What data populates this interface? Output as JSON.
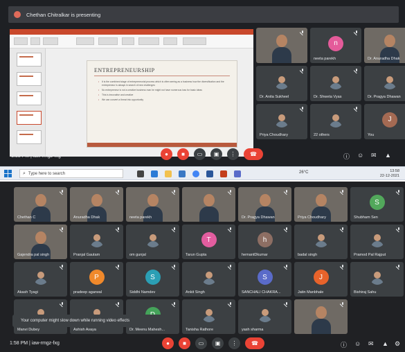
{
  "top": {
    "presenting_banner": "Chethan Chitralkar is presenting",
    "slide": {
      "title": "ENTREPRENEURSHIP",
      "bullets": [
        "It is the combined stage of entrepreneurial process which is often seeing as a business how the diversification and the entrepreneur is always in search of new challenges",
        "No entrepreneur is not a creative business man he might not have numerous loss for basic ideas",
        "This is innovative and creative",
        "We can convert a threat into opportunity"
      ]
    },
    "participants": [
      {
        "name": "",
        "type": "video"
      },
      {
        "name": "neeta parekh",
        "type": "letter",
        "letter": "n",
        "color": "#e45b9a"
      },
      {
        "name": "Dr. Anuradha Dhak",
        "type": "video"
      },
      {
        "name": "Dr. Anita Sukheel",
        "type": "photo"
      },
      {
        "name": "Dr. Shweta Vyas",
        "type": "photo"
      },
      {
        "name": "Dr. Pragya Dhawan",
        "type": "photo"
      },
      {
        "name": "Priya Choudhary",
        "type": "photo"
      },
      {
        "name": "22 others",
        "type": "group"
      },
      {
        "name": "You",
        "type": "letter",
        "letter": "J",
        "color": "#a46a53"
      }
    ],
    "meeting_info": "1:58 PM | iaw-rmgz-fxg"
  },
  "taskbar": {
    "search_placeholder": "Type here to search",
    "weather": "26°C",
    "time": "13:58",
    "date": "22-12-2021"
  },
  "bottom": {
    "participants": [
      {
        "name": "Chethan C",
        "type": "video"
      },
      {
        "name": "Anuradha Dhak",
        "type": "video"
      },
      {
        "name": "neeta parekh",
        "type": "video"
      },
      {
        "name": "",
        "type": "video"
      },
      {
        "name": "Dr. Pragya Dhawan",
        "type": "video"
      },
      {
        "name": "Priya Choudhary",
        "type": "video"
      },
      {
        "name": "Shubham Sen",
        "type": "letter",
        "letter": "S",
        "color": "#52a85b"
      },
      {
        "name": "Gajendra pal singh",
        "type": "video"
      },
      {
        "name": "Pranjal Gautam",
        "type": "photo"
      },
      {
        "name": "om gunjal",
        "type": "photo"
      },
      {
        "name": "Tarun Gupta",
        "type": "letter",
        "letter": "T",
        "color": "#e35d9f"
      },
      {
        "name": "hemantDkumar",
        "type": "letter",
        "letter": "h",
        "color": "#8d6e63"
      },
      {
        "name": "badal singh",
        "type": "photo"
      },
      {
        "name": "Pramod Pal Rajput",
        "type": "photo"
      },
      {
        "name": "Akash Tyagi",
        "type": "photo"
      },
      {
        "name": "pradeep agarwal",
        "type": "letter",
        "letter": "P",
        "color": "#f0892b"
      },
      {
        "name": "Siddhi Namdev",
        "type": "letter",
        "letter": "S",
        "color": "#2b9fb5"
      },
      {
        "name": "Ankit Singh",
        "type": "photo"
      },
      {
        "name": "SANCHALI CHAKRA...",
        "type": "letter",
        "letter": "S",
        "color": "#5a6bc9"
      },
      {
        "name": "Jatin Manbhale",
        "type": "letter",
        "letter": "J",
        "color": "#e8632b"
      },
      {
        "name": "Bishiraj Sahu",
        "type": "photo"
      },
      {
        "name": "Manvi Dubey",
        "type": "photo"
      },
      {
        "name": "Ashish Avaya",
        "type": "photo"
      },
      {
        "name": "Dr. Meenu Mahesh...",
        "type": "letter",
        "letter": "D",
        "color": "#45a35a"
      },
      {
        "name": "Tanisha Rathore",
        "type": "photo"
      },
      {
        "name": "yash sharma",
        "type": "photo"
      },
      {
        "name": "",
        "type": "video"
      }
    ],
    "notice": "Your computer might slow down while running video effects",
    "meeting_info": "1:58 PM | iaw-rmgz-fxg"
  },
  "colors": {
    "accent_red": "#ea4335",
    "tile_bg": "#3c4043",
    "meet_bg": "#202124"
  }
}
